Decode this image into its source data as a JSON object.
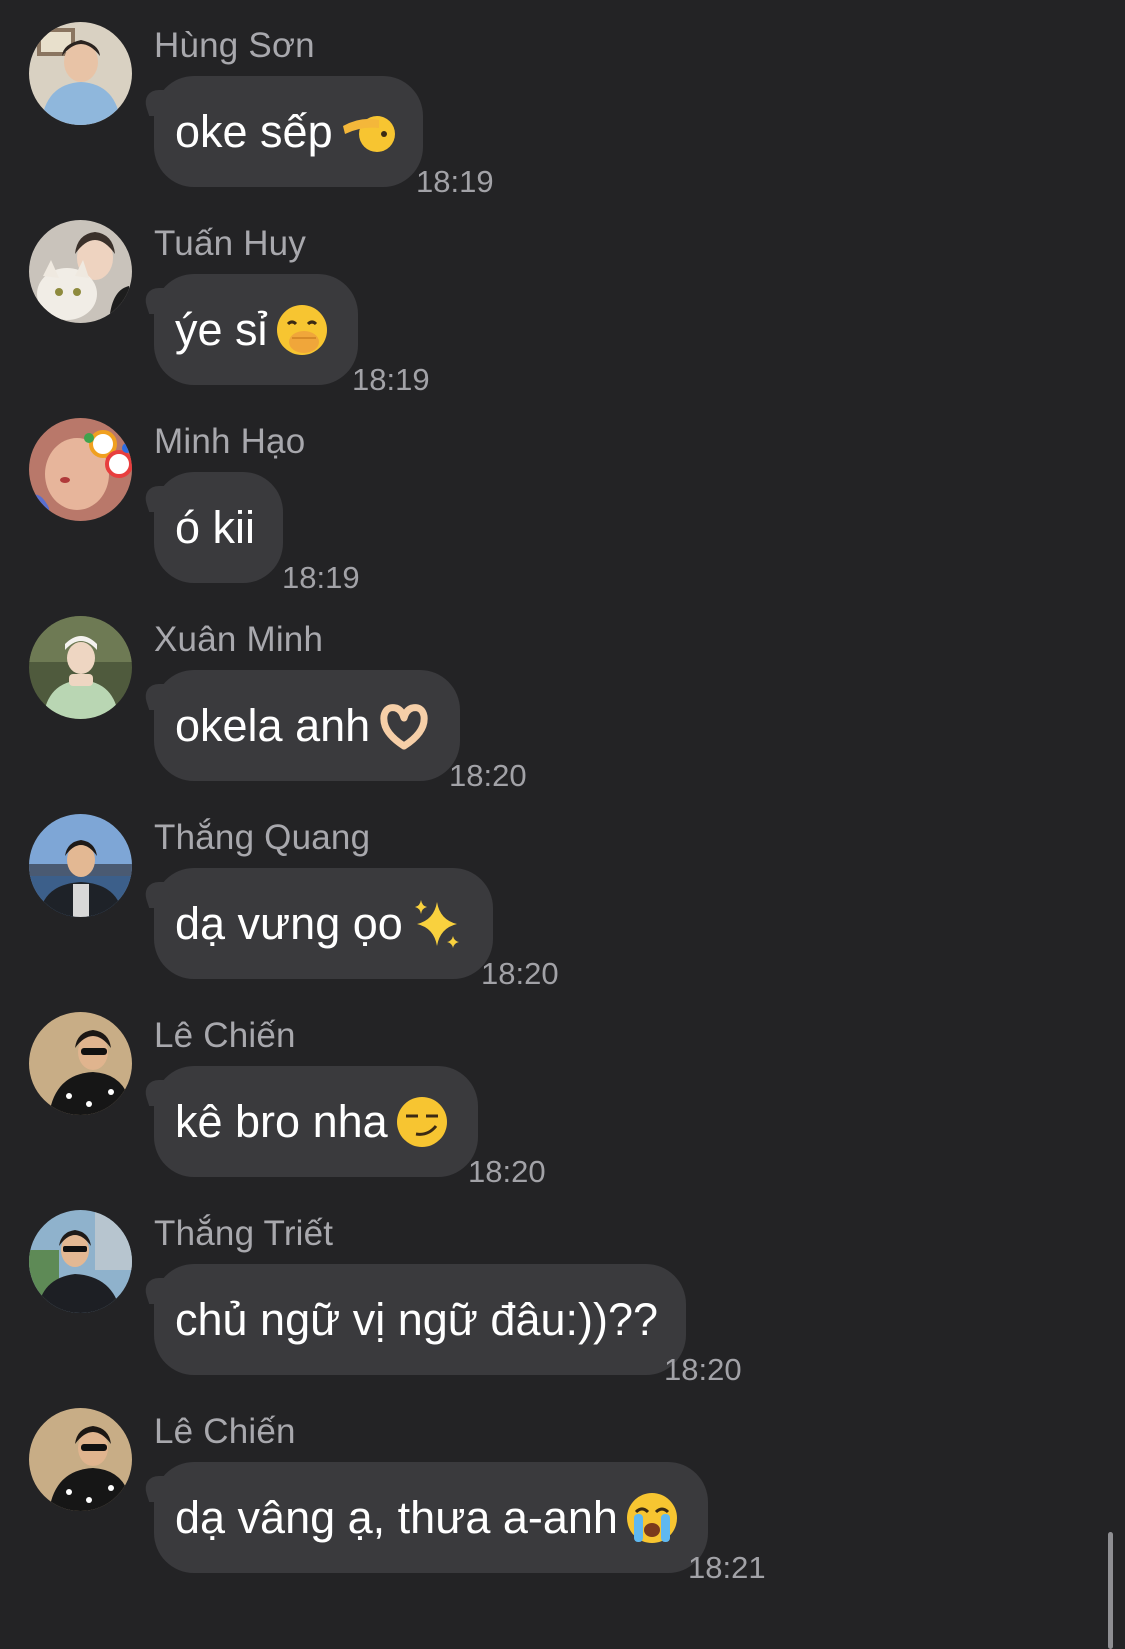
{
  "messages": [
    {
      "sender": "Hùng Sơn",
      "text": "oke sếp",
      "emoji": "saluting-face-icon",
      "time": "18:19"
    },
    {
      "sender": "Tuấn Huy",
      "text": "ýe sỉ",
      "emoji": "face-with-hand-over-mouth-icon",
      "time": "18:19"
    },
    {
      "sender": "Minh Hạo",
      "text": "ó kii",
      "emoji": "",
      "time": "18:19"
    },
    {
      "sender": "Xuân Minh",
      "text": "okela anh",
      "emoji": "heart-hands-icon",
      "time": "18:20"
    },
    {
      "sender": "Thắng Quang",
      "text": "dạ vưng ọo",
      "emoji": "sparkles-icon",
      "time": "18:20"
    },
    {
      "sender": "Lê Chiến",
      "text": "kê bro nha",
      "emoji": "smirking-face-icon",
      "time": "18:20"
    },
    {
      "sender": "Thắng Triết",
      "text": "chủ ngữ vị ngữ đâu:))??",
      "emoji": "",
      "time": "18:20"
    },
    {
      "sender": "Lê Chiến",
      "text": "dạ vâng ạ, thưa a-anh",
      "emoji": "loudly-crying-face-icon",
      "time": "18:21"
    }
  ],
  "colors": {
    "background": "#232325",
    "bubble": "#3a3a3d",
    "sender_name": "#a8a8ad",
    "timestamp": "#a2a2a7",
    "message_text": "#ffffff"
  }
}
